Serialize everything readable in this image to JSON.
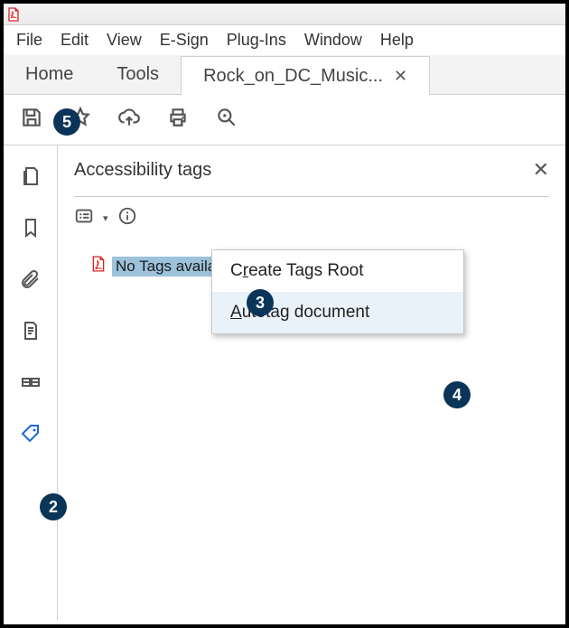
{
  "menubar": [
    "File",
    "Edit",
    "View",
    "E-Sign",
    "Plug-Ins",
    "Window",
    "Help"
  ],
  "tabs": {
    "home": "Home",
    "tools": "Tools",
    "doc": "Rock_on_DC_Music..."
  },
  "panel": {
    "title": "Accessibility tags",
    "tag_label": "No Tags available"
  },
  "context_menu": {
    "create_pre": "C",
    "create_u": "r",
    "create_post": "eate Tags Root",
    "auto_u": "A",
    "auto_post": "utotag document"
  },
  "badges": {
    "b2": "2",
    "b3": "3",
    "b4": "4",
    "b5": "5"
  }
}
